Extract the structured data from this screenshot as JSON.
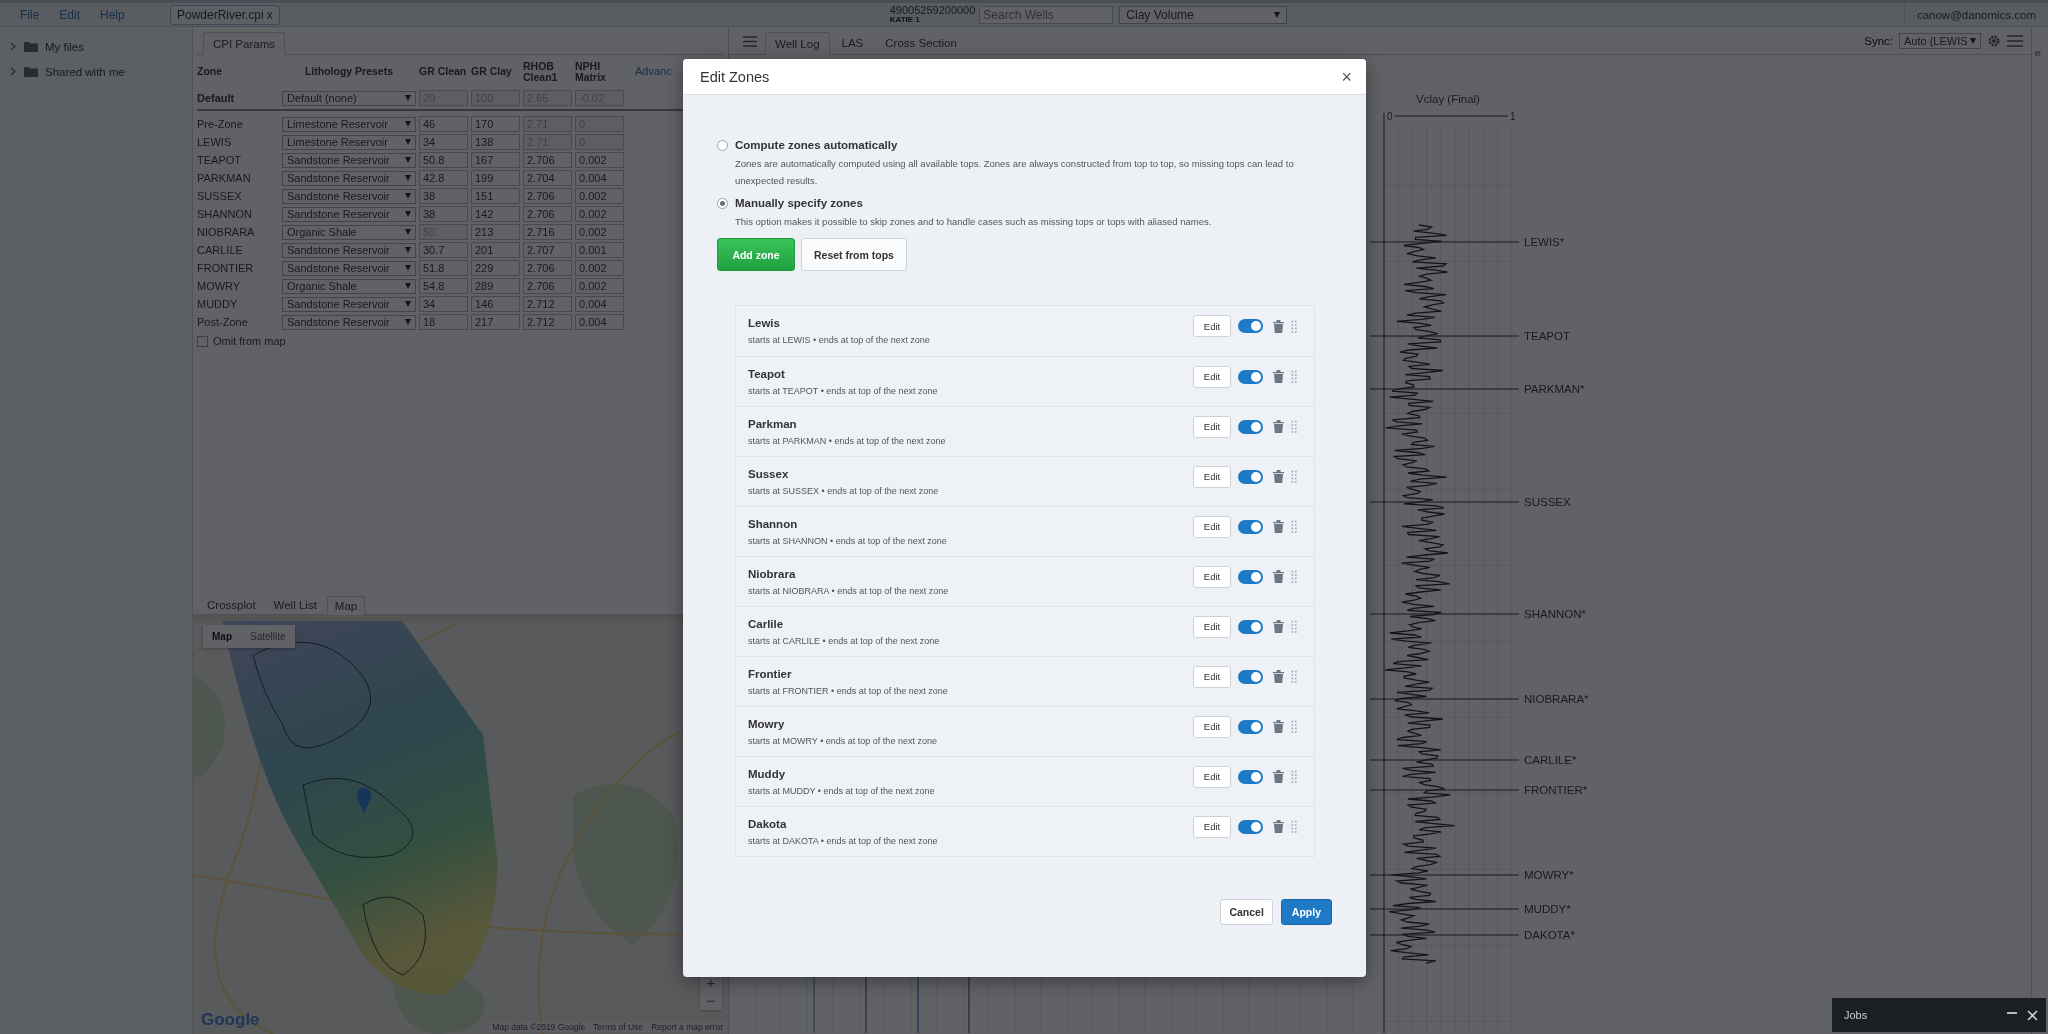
{
  "menu": [
    {
      "label": "File"
    },
    {
      "label": "Edit"
    },
    {
      "label": "Help"
    }
  ],
  "file_tab": {
    "label": "PowderRiver.cpi",
    "close": "x"
  },
  "well": {
    "uwi": "49005259200000",
    "name": "KATIE 1"
  },
  "search": {
    "placeholder": "Search Wells"
  },
  "curve_select": {
    "value": "Clay Volume"
  },
  "user": "canow@danomics.com",
  "sidebar": {
    "items": [
      {
        "label": "My files",
        "expanded": false
      },
      {
        "label": "Shared with me",
        "expanded": false
      }
    ]
  },
  "cpi": {
    "tabs": [
      {
        "label": "CPI Params",
        "selected": true
      }
    ],
    "columns": [
      "Zone",
      "Lithology Presets",
      "GR Clean",
      "GR Clay",
      "RHOB Clean1",
      "NPHI Matrix"
    ],
    "advanced_link": "Advanc",
    "default_row": {
      "zone": "Default",
      "lithology_preset": "Default (none)",
      "gr_clean": {
        "value": "20",
        "disabled": true
      },
      "gr_clay": {
        "value": "100",
        "disabled": true
      },
      "rhob_clean1": {
        "value": "2.65",
        "disabled": true
      },
      "nphi_matrix": {
        "value": "-0.02",
        "disabled": true
      }
    },
    "rows": [
      {
        "zone": "Pre-Zone",
        "lithology_preset": "Limestone Reservoir",
        "gr_clean": {
          "value": "46",
          "disabled": false
        },
        "gr_clay": {
          "value": "170",
          "disabled": false
        },
        "rhob_clean1": {
          "value": "2.71",
          "disabled": true
        },
        "nphi_matrix": {
          "value": "0",
          "disabled": true
        }
      },
      {
        "zone": "LEWIS",
        "lithology_preset": "Limestone Reservoir",
        "gr_clean": {
          "value": "34",
          "disabled": false
        },
        "gr_clay": {
          "value": "138",
          "disabled": false
        },
        "rhob_clean1": {
          "value": "2.71",
          "disabled": true
        },
        "nphi_matrix": {
          "value": "0",
          "disabled": true
        }
      },
      {
        "zone": "TEAPOT",
        "lithology_preset": "Sandstone Reservoir",
        "gr_clean": {
          "value": "50.8",
          "disabled": false
        },
        "gr_clay": {
          "value": "167",
          "disabled": false
        },
        "rhob_clean1": {
          "value": "2.706",
          "disabled": false
        },
        "nphi_matrix": {
          "value": "0.002",
          "disabled": false
        }
      },
      {
        "zone": "PARKMAN",
        "lithology_preset": "Sandstone Reservoir",
        "gr_clean": {
          "value": "42.8",
          "disabled": false
        },
        "gr_clay": {
          "value": "199",
          "disabled": false
        },
        "rhob_clean1": {
          "value": "2.704",
          "disabled": false
        },
        "nphi_matrix": {
          "value": "0.004",
          "disabled": false
        }
      },
      {
        "zone": "SUSSEX",
        "lithology_preset": "Sandstone Reservoir",
        "gr_clean": {
          "value": "38",
          "disabled": false
        },
        "gr_clay": {
          "value": "151",
          "disabled": false
        },
        "rhob_clean1": {
          "value": "2.706",
          "disabled": false
        },
        "nphi_matrix": {
          "value": "0.002",
          "disabled": false
        }
      },
      {
        "zone": "SHANNON",
        "lithology_preset": "Sandstone Reservoir",
        "gr_clean": {
          "value": "38",
          "disabled": false
        },
        "gr_clay": {
          "value": "142",
          "disabled": false
        },
        "rhob_clean1": {
          "value": "2.706",
          "disabled": false
        },
        "nphi_matrix": {
          "value": "0.002",
          "disabled": false
        }
      },
      {
        "zone": "NIOBRARA",
        "lithology_preset": "Organic Shale",
        "gr_clean": {
          "value": "50",
          "disabled": true
        },
        "gr_clay": {
          "value": "213",
          "disabled": false
        },
        "rhob_clean1": {
          "value": "2.716",
          "disabled": false
        },
        "nphi_matrix": {
          "value": "0.002",
          "disabled": false
        }
      },
      {
        "zone": "CARLILE",
        "lithology_preset": "Sandstone Reservoir",
        "gr_clean": {
          "value": "30.7",
          "disabled": false
        },
        "gr_clay": {
          "value": "201",
          "disabled": false
        },
        "rhob_clean1": {
          "value": "2.707",
          "disabled": false
        },
        "nphi_matrix": {
          "value": "0.001",
          "disabled": false
        }
      },
      {
        "zone": "FRONTIER",
        "lithology_preset": "Sandstone Reservoir",
        "gr_clean": {
          "value": "51.8",
          "disabled": false
        },
        "gr_clay": {
          "value": "229",
          "disabled": false
        },
        "rhob_clean1": {
          "value": "2.706",
          "disabled": false
        },
        "nphi_matrix": {
          "value": "0.002",
          "disabled": false
        }
      },
      {
        "zone": "MOWRY",
        "lithology_preset": "Organic Shale",
        "gr_clean": {
          "value": "54.8",
          "disabled": false
        },
        "gr_clay": {
          "value": "289",
          "disabled": false
        },
        "rhob_clean1": {
          "value": "2.706",
          "disabled": false
        },
        "nphi_matrix": {
          "value": "0.002",
          "disabled": false
        }
      },
      {
        "zone": "MUDDY",
        "lithology_preset": "Sandstone Reservoir",
        "gr_clean": {
          "value": "34",
          "disabled": false
        },
        "gr_clay": {
          "value": "146",
          "disabled": false
        },
        "rhob_clean1": {
          "value": "2.712",
          "disabled": false
        },
        "nphi_matrix": {
          "value": "0.004",
          "disabled": false
        }
      },
      {
        "zone": "Post-Zone",
        "lithology_preset": "Sandstone Reservoir",
        "gr_clean": {
          "value": "18",
          "disabled": false
        },
        "gr_clay": {
          "value": "217",
          "disabled": false
        },
        "rhob_clean1": {
          "value": "2.712",
          "disabled": false
        },
        "nphi_matrix": {
          "value": "0.004",
          "disabled": false
        }
      }
    ],
    "omit_from_map": {
      "label": "Omit from map",
      "checked": false
    }
  },
  "bottom_panel": {
    "tabs": [
      {
        "label": "Crossplot",
        "selected": false
      },
      {
        "label": "Well List",
        "selected": false
      },
      {
        "label": "Map",
        "selected": true
      }
    ],
    "map": {
      "kind": "picture",
      "type_buttons": [
        {
          "label": "Map",
          "selected": true
        },
        {
          "label": "Satellite",
          "selected": false
        }
      ],
      "zoom": [
        "+",
        "−"
      ],
      "logo": "Google",
      "footer": [
        "Map data ©2019 Google",
        "Terms of Use",
        "Report a map error"
      ]
    }
  },
  "log_panel": {
    "tabs": [
      {
        "label": "Well Log",
        "selected": true
      },
      {
        "label": "LAS",
        "selected": false
      },
      {
        "label": "Cross Section",
        "selected": false
      }
    ],
    "sync": {
      "label": "Sync:",
      "value": "Auto (LEWIS"
    },
    "collapse": "«",
    "track": {
      "title": "Vclay (Final)",
      "min": "0",
      "max": "1"
    },
    "tops": [
      "LEWIS*",
      "TEAPOT",
      "PARKMAN*",
      "SUSSEX",
      "SHANNON*",
      "NIOBRARA*",
      "CARLILE*",
      "FRONTIER*",
      "MOWRY*",
      "MUDDY*",
      "DAKOTA*"
    ]
  },
  "modal": {
    "title": "Edit Zones",
    "close": "×",
    "options": [
      {
        "label": "Compute zones automatically",
        "description": "Zones are automatically computed using all available tops. Zones are always constructed from top to top, so missing tops can lead to unexpected results.",
        "selected": false
      },
      {
        "label": "Manually specify zones",
        "description": "This option makes it possible to skip zones and to handle cases such as missing tops or tops with aliased names.",
        "selected": true
      }
    ],
    "actions": [
      {
        "label": "Add zone",
        "kind": "success"
      },
      {
        "label": "Reset from tops",
        "kind": "default"
      }
    ],
    "zones": [
      {
        "name": "Lewis",
        "detail": "starts at LEWIS • ends at top of the next zone",
        "edit": "Edit",
        "enabled": true
      },
      {
        "name": "Teapot",
        "detail": "starts at TEAPOT • ends at top of the next zone",
        "edit": "Edit",
        "enabled": true
      },
      {
        "name": "Parkman",
        "detail": "starts at PARKMAN • ends at top of the next zone",
        "edit": "Edit",
        "enabled": true
      },
      {
        "name": "Sussex",
        "detail": "starts at SUSSEX • ends at top of the next zone",
        "edit": "Edit",
        "enabled": true
      },
      {
        "name": "Shannon",
        "detail": "starts at SHANNON • ends at top of the next zone",
        "edit": "Edit",
        "enabled": true
      },
      {
        "name": "Niobrara",
        "detail": "starts at NIOBRARA • ends at top of the next zone",
        "edit": "Edit",
        "enabled": true
      },
      {
        "name": "Carlile",
        "detail": "starts at CARLILE • ends at top of the next zone",
        "edit": "Edit",
        "enabled": true
      },
      {
        "name": "Frontier",
        "detail": "starts at FRONTIER • ends at top of the next zone",
        "edit": "Edit",
        "enabled": true
      },
      {
        "name": "Mowry",
        "detail": "starts at MOWRY • ends at top of the next zone",
        "edit": "Edit",
        "enabled": true
      },
      {
        "name": "Muddy",
        "detail": "starts at MUDDY • ends at top of the next zone",
        "edit": "Edit",
        "enabled": true
      },
      {
        "name": "Dakota",
        "detail": "starts at DAKOTA • ends at top of the next zone",
        "edit": "Edit",
        "enabled": true
      }
    ],
    "footer": [
      {
        "label": "Cancel",
        "kind": "default"
      },
      {
        "label": "Apply",
        "kind": "primary"
      }
    ]
  },
  "jobs": {
    "title": "Jobs"
  }
}
